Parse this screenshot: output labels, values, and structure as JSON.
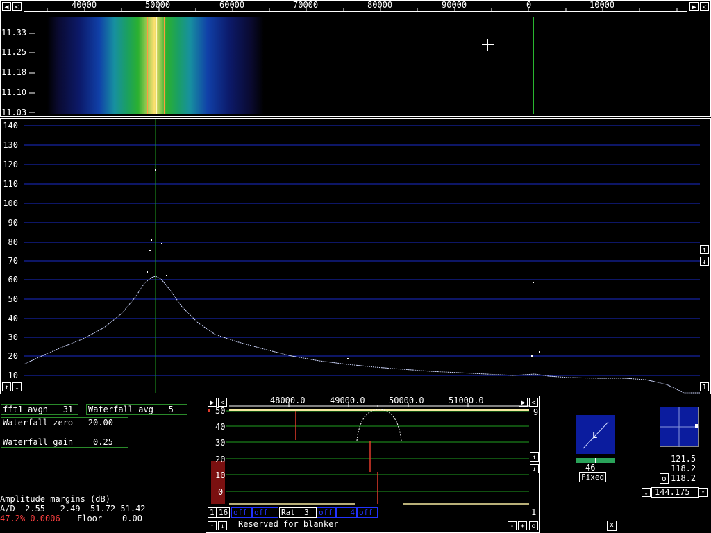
{
  "waterfall": {
    "freq_labels": [
      "40000",
      "50000",
      "60000",
      "70000",
      "80000",
      "90000",
      "0",
      "10000"
    ],
    "time_labels": [
      "11.33",
      "11.25",
      "11.18",
      "11.10",
      "11.03"
    ]
  },
  "spectrum": {
    "y_labels": [
      "140",
      "130",
      "120",
      "110",
      "100",
      "90",
      "80",
      "70",
      "60",
      "50",
      "40",
      "30",
      "20",
      "10"
    ]
  },
  "params": {
    "fft1_avgn": "fft1 avgn   31",
    "waterfall_avg": "Waterfall avg   5",
    "waterfall_zero": "Waterfall zero   20.00",
    "waterfall_gain": "Waterfall gain    0.25",
    "amp_title": "Amplitude margins (dB)",
    "ad_line": "A/D  2.55   2.49  51.72 51.42",
    "load_pct": "47.2% 0.0006",
    "floor": "Floor    0.00"
  },
  "baseband": {
    "freq_labels": [
      "48000.0",
      "49000.0",
      "50000.0",
      "51000.0"
    ],
    "y_labels": [
      "50",
      "40",
      "30",
      "20",
      "10",
      "0"
    ],
    "right_num": "9",
    "bottom_right_num": "1",
    "btn_1": "1",
    "btn_16": "16",
    "off1": "off",
    "off2": "off",
    "rat": "Rat  3",
    "off3": "off",
    "num4": "4",
    "off4": "off",
    "blanker": "Reserved for blanker",
    "minus": "-",
    "plus": "+",
    "o": "o"
  },
  "smeter": {
    "letter": "L",
    "value": "46",
    "mode": "Fixed"
  },
  "freq_panel": {
    "v1": "121.5",
    "v2": "118.2",
    "o_label": "o",
    "v3": "118.2",
    "main_freq": "144.175"
  },
  "close_x": "X",
  "colors": {
    "grid_blue": "#1a2dcc",
    "grid_green": "#1f9f1f",
    "marker_red": "#e23a2a",
    "trace_yellow": "#f5e9a0"
  }
}
